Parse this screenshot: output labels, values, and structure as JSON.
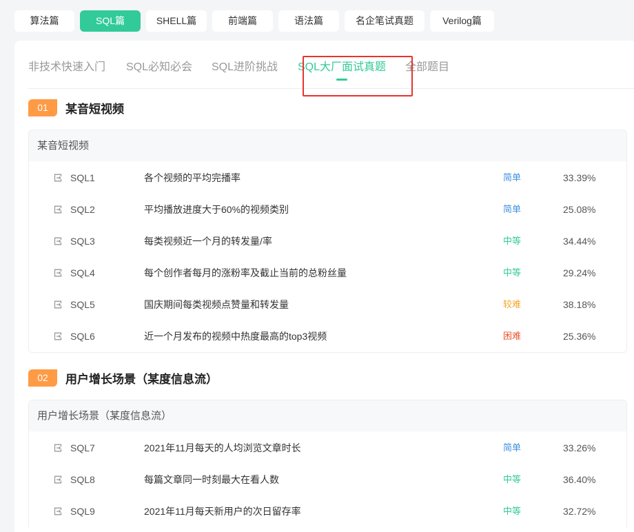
{
  "categories": [
    {
      "label": "算法篇",
      "active": false
    },
    {
      "label": "SQL篇",
      "active": true
    },
    {
      "label": "SHELL篇",
      "active": false
    },
    {
      "label": "前端篇",
      "active": false
    },
    {
      "label": "语法篇",
      "active": false
    },
    {
      "label": "名企笔试真题",
      "active": false
    },
    {
      "label": "Verilog篇",
      "active": false
    }
  ],
  "sub_tabs": [
    {
      "label": "非技术快速入门",
      "active": false
    },
    {
      "label": "SQL必知必会",
      "active": false
    },
    {
      "label": "SQL进阶挑战",
      "active": false
    },
    {
      "label": "SQL大厂面试真题",
      "active": true
    },
    {
      "label": "全部题目",
      "active": false
    }
  ],
  "difficulty_colors": {
    "简单": "#3f8fde",
    "中等": "#32ca99",
    "较难": "#f5a623",
    "困难": "#e8542e"
  },
  "sections": [
    {
      "number": "01",
      "title": "某音短视频",
      "group_name": "某音短视频",
      "questions": [
        {
          "code": "SQL1",
          "title": "各个视频的平均完播率",
          "difficulty": "简单",
          "pass_rate": "33.39%"
        },
        {
          "code": "SQL2",
          "title": "平均播放进度大于60%的视频类别",
          "difficulty": "简单",
          "pass_rate": "25.08%"
        },
        {
          "code": "SQL3",
          "title": "每类视频近一个月的转发量/率",
          "difficulty": "中等",
          "pass_rate": "34.44%"
        },
        {
          "code": "SQL4",
          "title": "每个创作者每月的涨粉率及截止当前的总粉丝量",
          "difficulty": "中等",
          "pass_rate": "29.24%"
        },
        {
          "code": "SQL5",
          "title": "国庆期间每类视频点赞量和转发量",
          "difficulty": "较难",
          "pass_rate": "38.18%"
        },
        {
          "code": "SQL6",
          "title": "近一个月发布的视频中热度最高的top3视频",
          "difficulty": "困难",
          "pass_rate": "25.36%"
        }
      ]
    },
    {
      "number": "02",
      "title": "用户增长场景（某度信息流）",
      "group_name": "用户增长场景（某度信息流）",
      "questions": [
        {
          "code": "SQL7",
          "title": "2021年11月每天的人均浏览文章时长",
          "difficulty": "简单",
          "pass_rate": "33.26%"
        },
        {
          "code": "SQL8",
          "title": "每篇文章同一时刻最大在看人数",
          "difficulty": "中等",
          "pass_rate": "36.40%"
        },
        {
          "code": "SQL9",
          "title": "2021年11月每天新用户的次日留存率",
          "difficulty": "中等",
          "pass_rate": "32.72%"
        }
      ]
    }
  ]
}
